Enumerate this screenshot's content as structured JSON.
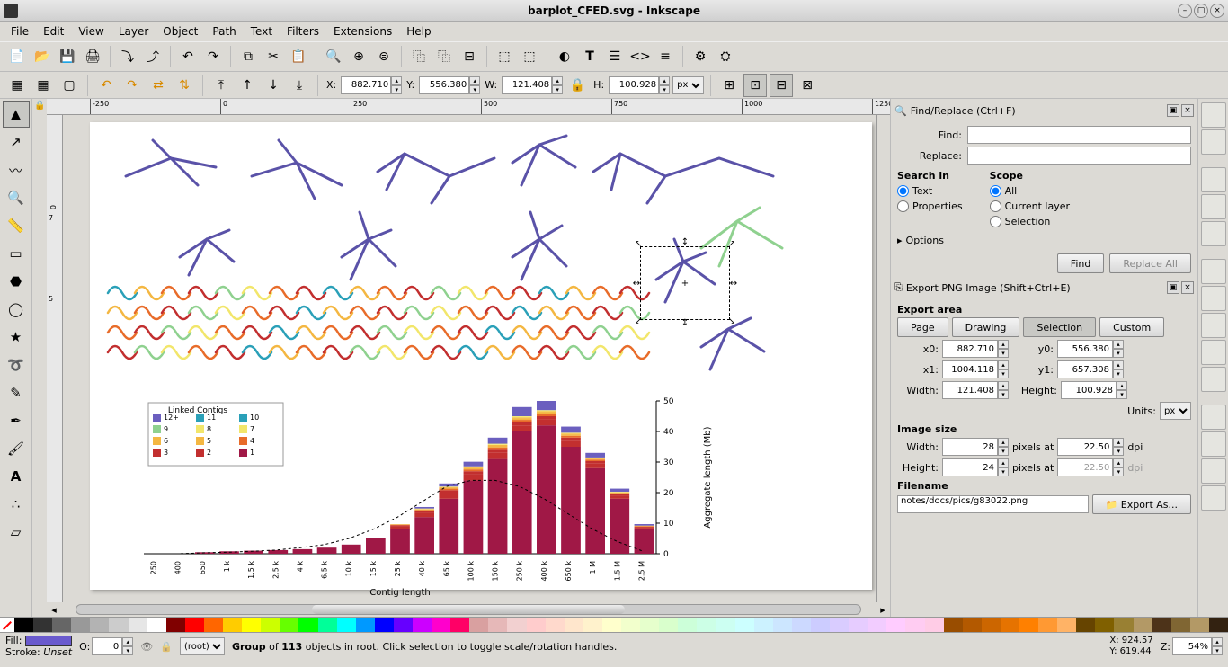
{
  "window": {
    "title": "barplot_CFED.svg - Inkscape"
  },
  "menu": [
    "File",
    "Edit",
    "View",
    "Layer",
    "Object",
    "Path",
    "Text",
    "Filters",
    "Extensions",
    "Help"
  ],
  "tooloptions": {
    "X": "882.710",
    "Y": "556.380",
    "W": "121.408",
    "H": "100.928",
    "unit": "px"
  },
  "find": {
    "title": "Find/Replace (Ctrl+F)",
    "find_label": "Find:",
    "replace_label": "Replace:",
    "searchin_label": "Search in",
    "scope_label": "Scope",
    "text_label": "Text",
    "properties_label": "Properties",
    "all_label": "All",
    "currentlayer_label": "Current layer",
    "selection_label": "Selection",
    "options_label": "Options",
    "find_btn": "Find",
    "replaceall_btn": "Replace All"
  },
  "export": {
    "title": "Export PNG Image (Shift+Ctrl+E)",
    "area_label": "Export area",
    "tabs": [
      "Page",
      "Drawing",
      "Selection",
      "Custom"
    ],
    "x0l": "x0:",
    "x0": "882.710",
    "y0l": "y0:",
    "y0": "556.380",
    "x1l": "x1:",
    "x1": "1004.118",
    "y1l": "y1:",
    "y1": "657.308",
    "widthl": "Width:",
    "width": "121.408",
    "heightl": "Height:",
    "height": "100.928",
    "unitsl": "Units:",
    "units": "px",
    "img_label": "Image size",
    "iw_l": "Width:",
    "iw": "28",
    "px_at": "pixels at",
    "dpi1": "22.50",
    "dpiu": "dpi",
    "ih_l": "Height:",
    "ih": "24",
    "dpi2": "22.50",
    "fname_label": "Filename",
    "fname": "notes/docs/pics/g83022.png",
    "exportas": "Export As..."
  },
  "status": {
    "fill_l": "Fill:",
    "stroke_l": "Stroke:",
    "stroke_v": "Unset",
    "o_l": "O:",
    "o_v": "0",
    "layer": "(root)",
    "msg_pre": "Group",
    "msg_of": "of",
    "msg_count": "113",
    "msg_post": "objects in root. Click selection to toggle scale/rotation handles.",
    "x": "924.57",
    "y": "619.44",
    "z_l": "Z:",
    "z": "54%"
  },
  "ruler_ticks": [
    -250,
    0,
    250,
    500,
    750,
    1000,
    1250
  ],
  "chart_data": {
    "type": "bar",
    "title": "",
    "xlabel": "Contig length",
    "ylabel": "Aggregate length (Mb)",
    "ylim": [
      0,
      50
    ],
    "yticks": [
      0,
      10,
      20,
      30,
      40,
      50
    ],
    "categories": [
      "250",
      "400",
      "650",
      "1 k",
      "1.5 k",
      "2.5 k",
      "4 k",
      "6.5 k",
      "10 k",
      "15 k",
      "25 k",
      "40 k",
      "65 k",
      "100 k",
      "150 k",
      "250 k",
      "400 k",
      "650 k",
      "1 M",
      "1.5 M",
      "2.5 M"
    ],
    "legend_title": "Linked Contigs",
    "legend_entries": [
      "12+",
      "11",
      "10",
      "9",
      "8",
      "7",
      "6",
      "5",
      "4",
      "3",
      "2",
      "1"
    ],
    "legend_colors": [
      "#6b5fbf",
      "#2aa0b8",
      "#2aa0b8",
      "#8fd18f",
      "#f2e66b",
      "#f2e66b",
      "#f4b742",
      "#f4b742",
      "#e86c2a",
      "#c22f2f",
      "#c22f2f",
      "#a01846"
    ],
    "series": [
      {
        "name": "1",
        "color": "#a01846",
        "values": [
          0,
          0,
          0.5,
          0.8,
          1,
          1.2,
          1.5,
          2,
          3,
          5,
          8,
          12,
          18,
          24,
          31,
          40,
          42,
          35,
          28,
          18,
          8
        ]
      },
      {
        "name": "2",
        "color": "#c22f2f",
        "values": [
          0,
          0,
          0,
          0,
          0,
          0,
          0,
          0,
          0,
          0,
          1,
          1.5,
          2,
          2,
          2,
          2,
          2,
          2,
          1.5,
          1,
          0.5
        ]
      },
      {
        "name": "3",
        "color": "#c22f2f",
        "values": [
          0,
          0,
          0,
          0,
          0,
          0,
          0,
          0,
          0,
          0,
          0.3,
          0.5,
          0.8,
          1,
          1,
          1,
          1,
          1,
          0.8,
          0.5,
          0.3
        ]
      },
      {
        "name": "4",
        "color": "#e86c2a",
        "values": [
          0,
          0,
          0,
          0,
          0,
          0,
          0,
          0,
          0,
          0,
          0.2,
          0.3,
          0.5,
          0.6,
          0.8,
          0.8,
          0.8,
          0.6,
          0.5,
          0.3,
          0.2
        ]
      },
      {
        "name": "5",
        "color": "#f4b742",
        "values": [
          0,
          0,
          0,
          0,
          0,
          0,
          0,
          0,
          0,
          0,
          0.1,
          0.2,
          0.3,
          0.4,
          0.5,
          0.5,
          0.5,
          0.4,
          0.3,
          0.2,
          0.1
        ]
      },
      {
        "name": "6",
        "color": "#f4b742",
        "values": [
          0,
          0,
          0,
          0,
          0,
          0,
          0,
          0,
          0,
          0,
          0.1,
          0.1,
          0.2,
          0.3,
          0.3,
          0.3,
          0.3,
          0.3,
          0.2,
          0.1,
          0.1
        ]
      },
      {
        "name": "7",
        "color": "#f2e66b",
        "values": [
          0,
          0,
          0,
          0,
          0,
          0,
          0,
          0,
          0,
          0,
          0,
          0.1,
          0.1,
          0.2,
          0.2,
          0.2,
          0.2,
          0.2,
          0.1,
          0.1,
          0
        ]
      },
      {
        "name": "8",
        "color": "#f2e66b",
        "values": [
          0,
          0,
          0,
          0,
          0,
          0,
          0,
          0,
          0,
          0,
          0,
          0.1,
          0.1,
          0.1,
          0.2,
          0.2,
          0.2,
          0.1,
          0.1,
          0.1,
          0
        ]
      },
      {
        "name": "12+",
        "color": "#6b5fbf",
        "values": [
          0,
          0,
          0,
          0,
          0,
          0,
          0,
          0,
          0,
          0,
          0,
          0.5,
          1,
          1.5,
          2,
          3,
          3,
          2,
          1.5,
          1,
          0.5
        ]
      }
    ],
    "density_line": [
      0,
      0,
      0.3,
      0.5,
      0.8,
      1.2,
      2,
      3,
      5,
      8,
      12,
      17,
      22,
      24,
      24,
      22,
      18,
      13,
      8,
      4,
      1
    ]
  },
  "palette_colors": [
    "#000000",
    "#333333",
    "#666666",
    "#999999",
    "#b3b3b3",
    "#cccccc",
    "#e6e6e6",
    "#ffffff",
    "#800000",
    "#ff0000",
    "#ff6600",
    "#ffcc00",
    "#ffff00",
    "#ccff00",
    "#66ff00",
    "#00ff00",
    "#00ff99",
    "#00ffff",
    "#0099ff",
    "#0000ff",
    "#6600ff",
    "#cc00ff",
    "#ff00cc",
    "#ff0066",
    "#d9a0a0",
    "#e6b8b8",
    "#f2d0d0",
    "#ffcccc",
    "#ffd9cc",
    "#ffe6cc",
    "#fff2cc",
    "#ffffcc",
    "#f2ffcc",
    "#e6ffcc",
    "#d9ffcc",
    "#ccffd9",
    "#ccffe6",
    "#ccfff2",
    "#ccffff",
    "#ccf2ff",
    "#cce6ff",
    "#ccd9ff",
    "#ccccff",
    "#d9ccff",
    "#e6ccff",
    "#f2ccff",
    "#ffccff",
    "#ffccf2",
    "#ffcce6",
    "#994d00",
    "#b35900",
    "#cc6600",
    "#e67300",
    "#ff8000",
    "#ff9933",
    "#ffb366",
    "#664400",
    "#806000",
    "#998033",
    "#b39966",
    "#4d3319",
    "#806633",
    "#b39966",
    "#332211"
  ]
}
